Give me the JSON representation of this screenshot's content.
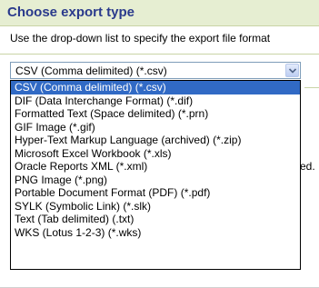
{
  "header": {
    "title": "Choose export type"
  },
  "instruction": "Use the drop-down list to specify the export file format",
  "background_text": {
    "fragment1": "",
    "fragment2": "ed."
  },
  "select": {
    "value": "CSV (Comma delimited) (*.csv)",
    "arrow_icon": "chevron-down-icon"
  },
  "dropdown": {
    "selected_index": 0,
    "options": [
      "CSV (Comma delimited) (*.csv)",
      "DIF (Data Interchange Format) (*.dif)",
      "Formatted Text (Space delimited) (*.prn)",
      "GIF Image (*.gif)",
      "Hyper-Text Markup Language (archived) (*.zip)",
      "Microsoft Excel Workbook (*.xls)",
      "Oracle Reports XML (*.xml)",
      "PNG Image (*.png)",
      "Portable Document Format (PDF) (*.pdf)",
      "SYLK (Symbolic Link) (*.slk)",
      "Text (Tab delimited) (.txt)",
      "WKS (Lotus 1-2-3) (*.wks)"
    ]
  },
  "colors": {
    "header_bg": "#e6eed2",
    "title": "#2a3a8c",
    "selection": "#316ac5"
  }
}
